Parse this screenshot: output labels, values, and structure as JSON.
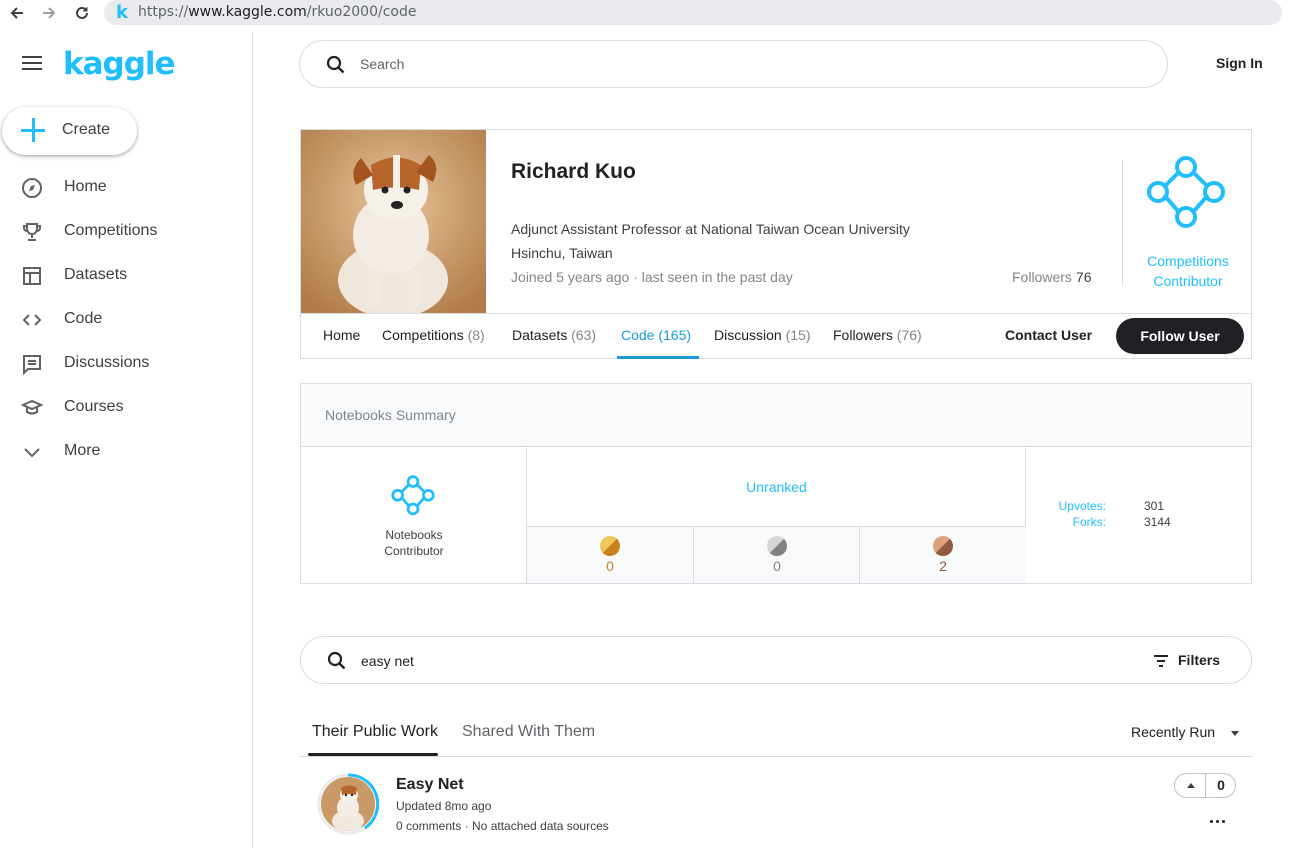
{
  "browser": {
    "url_prefix": "https://",
    "url_domain": "www.kaggle.com",
    "url_path": "/rkuo2000/code",
    "favicon": "k"
  },
  "sidebar": {
    "logo": "kaggle",
    "create_label": "Create",
    "items": [
      {
        "label": "Home",
        "icon": "compass-icon"
      },
      {
        "label": "Competitions",
        "icon": "trophy-icon"
      },
      {
        "label": "Datasets",
        "icon": "table-icon"
      },
      {
        "label": "Code",
        "icon": "code-icon"
      },
      {
        "label": "Discussions",
        "icon": "comment-icon"
      },
      {
        "label": "Courses",
        "icon": "graduation-cap-icon"
      },
      {
        "label": "More",
        "icon": "chevron-down-icon"
      }
    ]
  },
  "header": {
    "search_placeholder": "Search",
    "sign_in": "Sign In"
  },
  "profile": {
    "name": "Richard Kuo",
    "occupation": "Adjunct Assistant Professor at National Taiwan Ocean University",
    "location": "Hsinchu, Taiwan",
    "joined": "Joined 5 years ago · last seen in the past day",
    "followers_label": "Followers",
    "followers_count": "76",
    "tier_line1": "Competitions",
    "tier_line2": "Contributor",
    "tabs": [
      {
        "label": "Home",
        "count": ""
      },
      {
        "label": "Competitions",
        "count": "(8)"
      },
      {
        "label": "Datasets",
        "count": "(63)"
      },
      {
        "label": "Code",
        "count": "(165)"
      },
      {
        "label": "Discussion",
        "count": "(15)"
      },
      {
        "label": "Followers",
        "count": "(76)"
      }
    ],
    "contact_user": "Contact User",
    "follow_user": "Follow User"
  },
  "notebooks_summary": {
    "title": "Notebooks Summary",
    "tier_line1": "Notebooks",
    "tier_line2": "Contributor",
    "rank": "Unranked",
    "medals": [
      {
        "type": "gold",
        "count": "0",
        "color": "#c9821b"
      },
      {
        "type": "silver",
        "count": "0",
        "color": "#838280"
      },
      {
        "type": "bronze",
        "count": "2",
        "color": "#8e5b3d"
      }
    ],
    "upvotes_label": "Upvotes:",
    "upvotes": "301",
    "forks_label": "Forks:",
    "forks": "3144"
  },
  "code_search": {
    "value": "easy net",
    "filters_label": "Filters"
  },
  "work_tabs": {
    "public": "Their Public Work",
    "shared": "Shared With Them",
    "sort": "Recently Run"
  },
  "notebook": {
    "title": "Easy Net",
    "updated": "Updated 8mo ago",
    "meta": "0 comments · No attached data sources",
    "votes": "0"
  },
  "colors": {
    "accent": "#20beff",
    "link_active": "#1a9bd8",
    "dark_button": "#202124"
  }
}
